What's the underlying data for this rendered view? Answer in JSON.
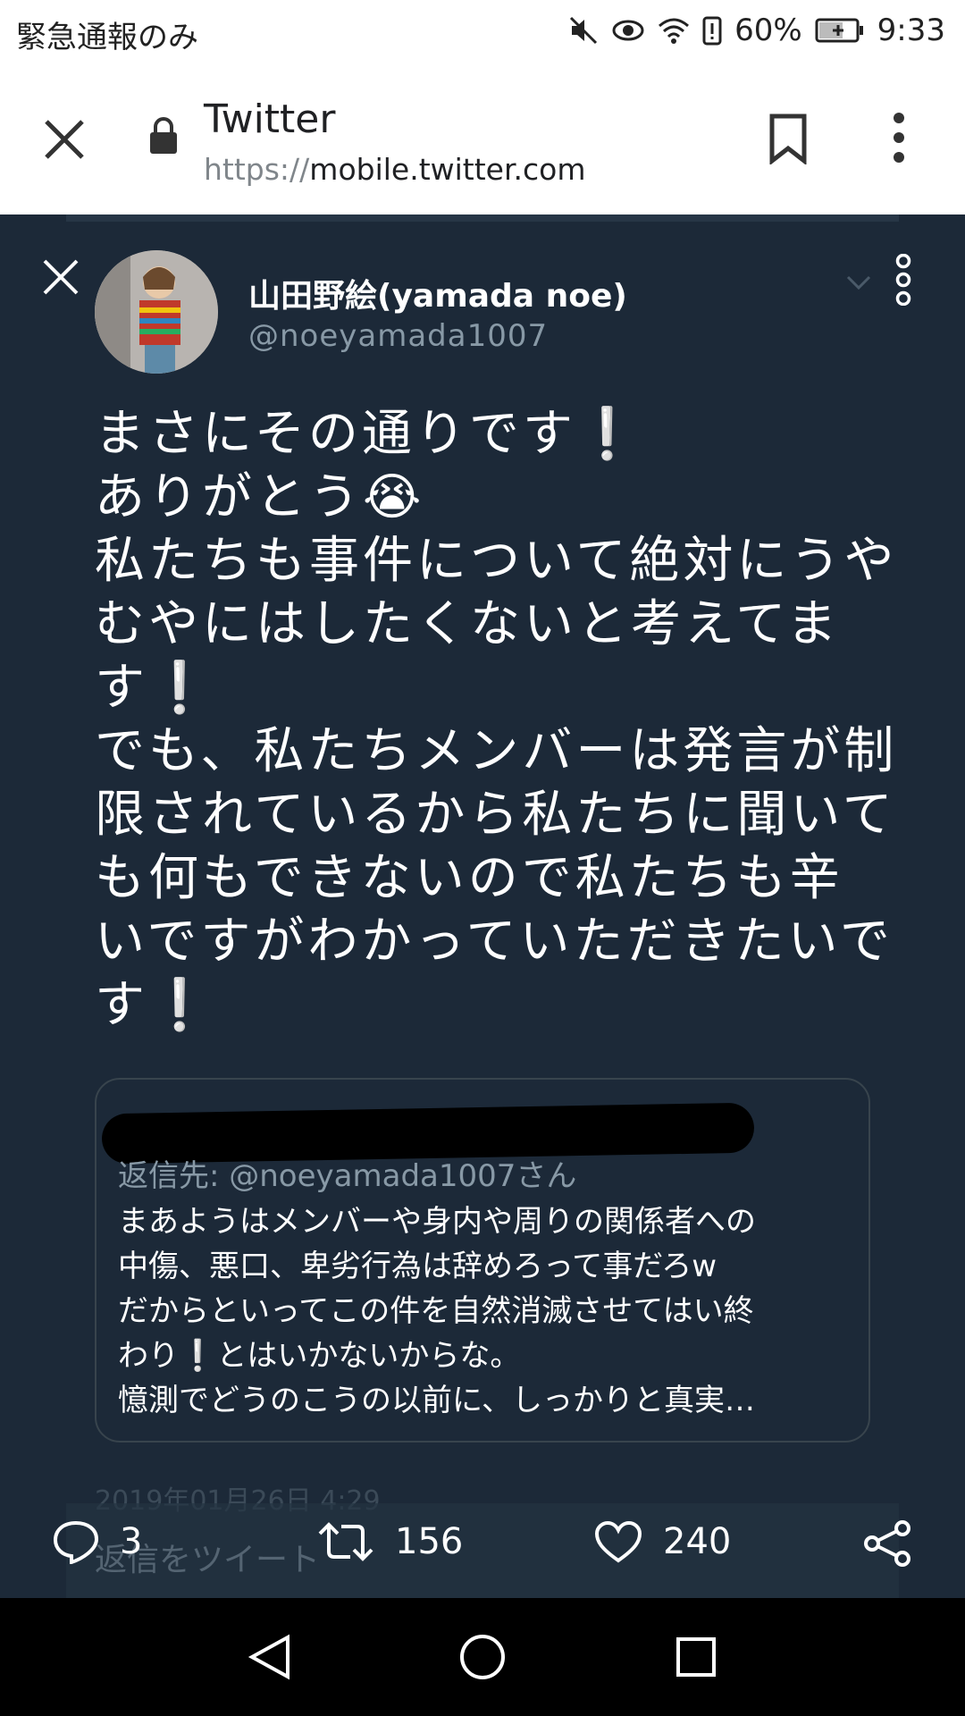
{
  "status_bar": {
    "carrier": "緊急通報のみ",
    "battery": "60%",
    "time": "9:33"
  },
  "browser": {
    "title": "Twitter",
    "url_scheme": "https://",
    "url_host": "mobile.twitter.com"
  },
  "tweet": {
    "name": "山田野絵(yamada noe)",
    "handle": "@noeyamada1007",
    "text": "まさにその通りです❕\nありがとう😭\n私たちも事件について絶対にうや\nむやにはしたくないと考えてま\nす❕\nでも、私たちメンバーは発言が制\n限されているから私たちに聞いて\nも何もできないので私たちも辛\nいですがわかっていただきたいで\nす❕",
    "quote": {
      "reply_to": "返信先: @noeyamada1007さん",
      "text": "まあようはメンバーや身内や周りの関係者への\n中傷、悪口、卑劣行為は辞めろって事だろw\nだからといってこの件を自然消滅させてはい終\nわり❕とはいかないからな。\n憶測でどうのこうの以前に、しっかりと真実…"
    },
    "timestamp": "2019年01月26日 4:29",
    "reply_placeholder": "返信をツイート"
  },
  "actions": {
    "replies": "3",
    "retweets": "156",
    "likes": "240"
  },
  "colors": {
    "background": "#1c2938",
    "text": "#ffffff",
    "secondary": "#8899a6"
  }
}
